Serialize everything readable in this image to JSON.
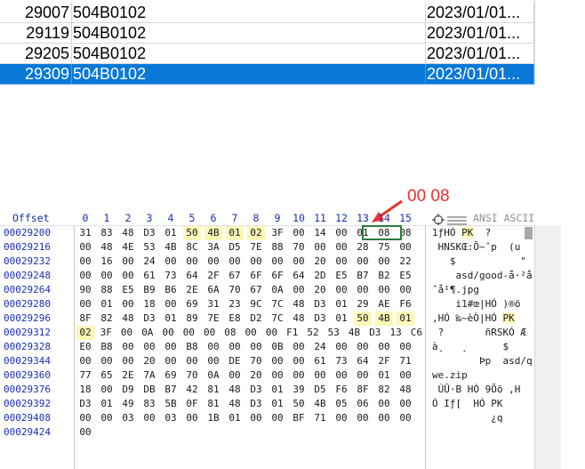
{
  "grid": {
    "rows": [
      {
        "id": "29007",
        "code": "504B0102",
        "date": "2023/01/01...",
        "selected": false
      },
      {
        "id": "29119",
        "code": "504B0102",
        "date": "2023/01/01...",
        "selected": false
      },
      {
        "id": "29205",
        "code": "504B0102",
        "date": "2023/01/01...",
        "selected": false
      },
      {
        "id": "29309",
        "code": "504B0102",
        "date": "2023/01/01...",
        "selected": true
      }
    ]
  },
  "annotation": {
    "text": "00 08",
    "color": "#e8322d"
  },
  "hex": {
    "header": {
      "offset_label": "Offset",
      "columns": [
        "0",
        "1",
        "2",
        "3",
        "4",
        "5",
        "6",
        "7",
        "8",
        "9",
        "10",
        "11",
        "12",
        "13",
        "14",
        "15"
      ],
      "ascii_label": "ANSI ASCII"
    },
    "rows": [
      {
        "offset": "00029200",
        "bytes": [
          "31",
          "83",
          "48",
          "D3",
          "01",
          "50",
          "4B",
          "01",
          "02",
          "3F",
          "00",
          "14",
          "00",
          "01",
          "08",
          "08"
        ],
        "ascii": "1ƒHÓ PK  ?"
      },
      {
        "offset": "00029216",
        "bytes": [
          "00",
          "48",
          "4E",
          "53",
          "4B",
          "8C",
          "3A",
          "D5",
          "7E",
          "88",
          "70",
          "00",
          "00",
          "28",
          "75",
          "00"
        ],
        "ascii": " HNSKŒ:Õ~ˆp  (u"
      },
      {
        "offset": "00029232",
        "bytes": [
          "00",
          "16",
          "00",
          "24",
          "00",
          "00",
          "00",
          "00",
          "00",
          "00",
          "00",
          "20",
          "00",
          "00",
          "00",
          "22"
        ],
        "ascii": "   $           \""
      },
      {
        "offset": "00029248",
        "bytes": [
          "00",
          "00",
          "00",
          "61",
          "73",
          "64",
          "2F",
          "67",
          "6F",
          "6F",
          "64",
          "2D",
          "E5",
          "B7",
          "B2",
          "E5"
        ],
        "ascii": "    asd/good-å·²å"
      },
      {
        "offset": "00029264",
        "bytes": [
          "90",
          "88",
          "E5",
          "B9",
          "B6",
          "2E",
          "6A",
          "70",
          "67",
          "0A",
          "00",
          "20",
          "00",
          "00",
          "00",
          "00"
        ],
        "ascii": "ˆå¹¶.jpg"
      },
      {
        "offset": "00029280",
        "bytes": [
          "00",
          "01",
          "00",
          "18",
          "00",
          "69",
          "31",
          "23",
          "9C",
          "7C",
          "48",
          "D3",
          "01",
          "29",
          "AE",
          "F6"
        ],
        "ascii": "    i1#œ|HÓ )®ö"
      },
      {
        "offset": "00029296",
        "bytes": [
          "8F",
          "82",
          "48",
          "D3",
          "01",
          "89",
          "7E",
          "E8",
          "D2",
          "7C",
          "48",
          "D3",
          "01",
          "50",
          "4B",
          "01"
        ],
        "ascii": ",HÓ ‰~èÒ|HÓ PK"
      },
      {
        "offset": "00029312",
        "bytes": [
          "02",
          "3F",
          "00",
          "0A",
          "00",
          "00",
          "00",
          "08",
          "00",
          "00",
          "F1",
          "52",
          "53",
          "4B",
          "D3",
          "13",
          "C6"
        ],
        "ascii": " ?       ñRSKÓ Æ"
      },
      {
        "offset": "00029328",
        "bytes": [
          "E0",
          "B8",
          "00",
          "00",
          "00",
          "B8",
          "00",
          "00",
          "00",
          "0B",
          "00",
          "24",
          "00",
          "00",
          "00",
          "00"
        ],
        "ascii": "à¸   ¸      $"
      },
      {
        "offset": "00029344",
        "bytes": [
          "00",
          "00",
          "00",
          "20",
          "00",
          "00",
          "00",
          "DE",
          "70",
          "00",
          "00",
          "61",
          "73",
          "64",
          "2F",
          "71"
        ],
        "ascii": "        Þp  asd/q"
      },
      {
        "offset": "00029360",
        "bytes": [
          "77",
          "65",
          "2E",
          "7A",
          "69",
          "70",
          "0A",
          "00",
          "20",
          "00",
          "00",
          "00",
          "00",
          "00",
          "01",
          "00"
        ],
        "ascii": "we.zip"
      },
      {
        "offset": "00029376",
        "bytes": [
          "18",
          "00",
          "D9",
          "DB",
          "B7",
          "42",
          "81",
          "48",
          "D3",
          "01",
          "39",
          "D5",
          "F6",
          "8F",
          "82",
          "48"
        ],
        "ascii": " ÙÛ·B HÓ 9Õö ,H"
      },
      {
        "offset": "00029392",
        "bytes": [
          "D3",
          "01",
          "49",
          "83",
          "5B",
          "0F",
          "81",
          "48",
          "D3",
          "01",
          "50",
          "4B",
          "05",
          "06",
          "00",
          "00"
        ],
        "ascii": "Ó Iƒ[  HÓ PK"
      },
      {
        "offset": "00029408",
        "bytes": [
          "00",
          "00",
          "03",
          "00",
          "03",
          "00",
          "1B",
          "01",
          "00",
          "00",
          "BF",
          "71",
          "00",
          "00",
          "00",
          "00"
        ],
        "ascii": "          ¿q"
      },
      {
        "offset": "00029424",
        "bytes": [
          "00"
        ],
        "ascii": ""
      }
    ]
  },
  "colors": {
    "selection": "#0a78d7",
    "offset_text": "#1a2fb0",
    "byte_highlight": "#fdf7b8",
    "box_highlight": "#2d7c3c"
  },
  "icons": [
    "target-icon",
    "lines-icon"
  ]
}
